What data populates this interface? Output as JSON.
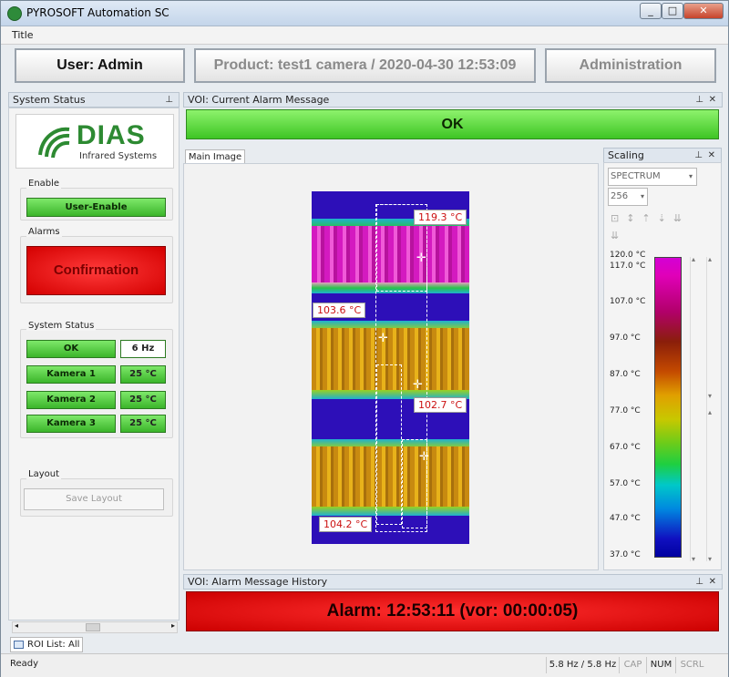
{
  "app": {
    "title": "PYROSOFT Automation SC"
  },
  "menu": {
    "title": "Title"
  },
  "header": {
    "user": "User: Admin",
    "product": "Product: test1 camera / 2020-04-30 12:53:09",
    "administration": "Administration"
  },
  "system_status_panel": {
    "title": "System Status",
    "logo": {
      "name": "DIAS",
      "subtitle": "Infrared Systems"
    },
    "enable_group": {
      "title": "Enable",
      "button": "User-Enable"
    },
    "alarms_group": {
      "title": "Alarms",
      "button": "Confirmation"
    },
    "status_group": {
      "title": "System Status",
      "rows": [
        {
          "label": "OK",
          "value": "6 Hz"
        },
        {
          "label": "Kamera 1",
          "value": "25 °C"
        },
        {
          "label": "Kamera 2",
          "value": "25 °C"
        },
        {
          "label": "Kamera 3",
          "value": "25 °C"
        }
      ]
    },
    "layout_group": {
      "title": "Layout",
      "button": "Save Layout"
    }
  },
  "alarm_message_panel": {
    "title": "VOI: Current Alarm Message",
    "message": "OK"
  },
  "main_image": {
    "tab": "Main Image",
    "temperatures": [
      "119.3 °C",
      "103.6 °C",
      "102.7 °C",
      "104.2 °C"
    ]
  },
  "scaling_panel": {
    "title": "Scaling",
    "palette": "SPECTRUM",
    "levels": "256",
    "scale_labels": [
      "120.0 °C",
      "117.0 °C",
      "107.0 °C",
      "97.0 °C",
      "87.0 °C",
      "77.0 °C",
      "67.0 °C",
      "57.0 °C",
      "47.0 °C",
      "37.0 °C"
    ]
  },
  "history_panel": {
    "title": "VOI: Alarm Message History",
    "message": "Alarm: 12:53:11 (vor: 00:00:05)"
  },
  "bottom_tab": {
    "label": "ROI List: All"
  },
  "statusbar": {
    "status": "Ready",
    "rate": "5.8 Hz / 5.8 Hz",
    "cap": "CAP",
    "num": "NUM",
    "scrl": "SCRL"
  }
}
